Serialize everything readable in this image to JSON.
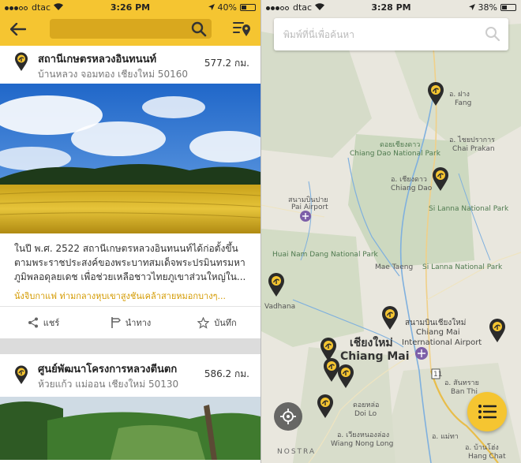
{
  "colors": {
    "accent": "#f5c531",
    "accent_dark": "#d9a81e",
    "link": "#d49a00"
  },
  "left": {
    "status": {
      "carrier": "dtac",
      "time": "3:26 PM",
      "battery": "40%",
      "battery_level": 0.4
    },
    "header": {
      "back_icon": "arrow-left-icon",
      "search_icon": "search-icon",
      "map_icon": "map-list-pin-icon"
    },
    "place1": {
      "title": "สถานีเกษตรหลวงอินทนนท์",
      "address": "บ้านหลวง จอมทอง เชียงใหม่ 50160",
      "distance": "577.2 กม.",
      "description": "ในปี พ.ศ. 2522 สถานีเกษตรหลวงอินทนนท์ได้ก่อตั้งขึ้นตามพระราชประสงค์ของพระบาทสมเด็จพระปรมินทรมหาภูมิพลอดุลยเดช เพื่อช่วยเหลือชาวไทยภูเขาส่วนใหญ่ใน...",
      "more": "นั่งจิบกาแฟ ท่ามกลางหุบเขาสูงชันเคล้าสายหมอกบางๆ...",
      "actions": {
        "share": "แชร์",
        "navigate": "นำทาง",
        "save": "บันทึก"
      }
    },
    "place2": {
      "title": "ศูนย์พัฒนาโครงการหลวงตีนตก",
      "address": "ห้วยแก้ว แม่ออน เชียงใหม่ 50130",
      "distance": "586.2 กม."
    }
  },
  "right": {
    "status": {
      "carrier": "dtac",
      "time": "3:28 PM",
      "battery": "38%",
      "battery_level": 0.38
    },
    "search": {
      "placeholder": "พิมพ์ที่นี่เพื่อค้นหา"
    },
    "map_labels": {
      "chiang_mai_th": "เชียงใหม่",
      "chiang_mai_en": "Chiang Mai",
      "airport_th": "สนามบินเชียงใหม่",
      "airport_en1": "Chiang Mai",
      "airport_en2": "International Airport",
      "pai_th": "สนามบินปาย",
      "pai_en": "Pai Airport",
      "fang_th": "อ. ฝาง",
      "fang_en": "Fang",
      "chai_prakan_th": "อ. ไชยปราการ",
      "chai_prakan_en": "Chai Prakan",
      "chiang_dao_park_th": "ดอยเชียงดาว",
      "chiang_dao_park_en": "Chiang Dao National Park",
      "chiang_dao_th": "อ. เชียงดาว",
      "chiang_dao_en": "Chiang Dao",
      "si_lanna": "Si Lanna National Park",
      "huai_nam_dang": "Huai Nam Dang National Park",
      "mae_taeng": "Mae Taeng",
      "si_lanna2": "Si Lanna National Park",
      "wadhana": "Vadhana",
      "doi_lo_th": "ดอยหล่อ",
      "doi_lo_en": "Doi Lo",
      "san_kamphaeng": "อ. สันทราย",
      "ban_thi": "Ban Thi",
      "wiang_nong_long_th": "อ. เวียงหนองล่อง",
      "wiang_nong_long_en": "Wiang Nong Long",
      "ban_hong_th": "อ. บ้านโฮ่ง",
      "mae_tha_th": "อ. แม่ทา",
      "hang_chat": "Hang Chat",
      "route_11": "11",
      "attribution": "NOSTRA"
    },
    "locate_icon": "crosshair-locate-icon",
    "list_icon": "list-icon"
  }
}
